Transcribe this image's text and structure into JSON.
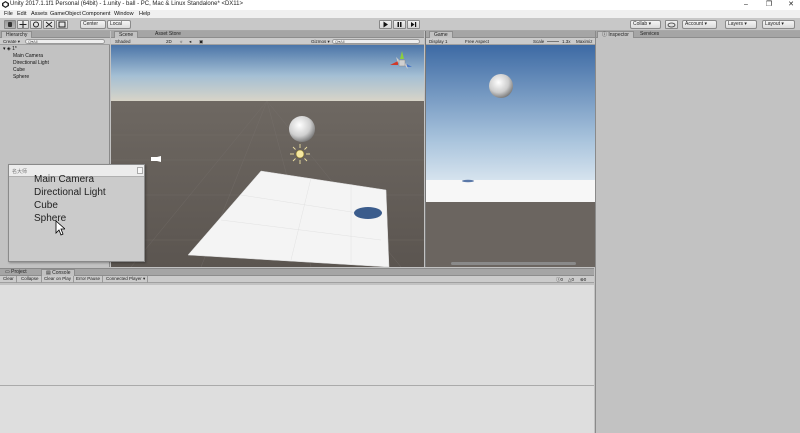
{
  "window": {
    "title": "Unity 2017.1.1f1 Personal (64bit) - 1.unity - ball - PC, Mac & Linux Standalone* <DX11>",
    "controls": [
      "–",
      "❐",
      "✕"
    ]
  },
  "menu": [
    "File",
    "Edit",
    "Assets",
    "GameObject",
    "Component",
    "Window",
    "Help"
  ],
  "toolbar": {
    "pivot": "Center",
    "space": "Local",
    "collab": "Collab ▾",
    "account": "Account ▾",
    "layers": "Layers ▾",
    "layout": "Layout ▾"
  },
  "hierarchy": {
    "tab": "Hierarchy",
    "create": "Create ▾",
    "search_placeholder": "Q▾All",
    "scene_name": "1*",
    "items": [
      "Main Camera",
      "Directional Light",
      "Cube",
      "Sphere"
    ]
  },
  "scene": {
    "tabs": [
      "Scene",
      "Asset Store"
    ],
    "shading": "Shaded",
    "mode_2d": "2D",
    "gizmos": "Gizmos ▾",
    "search_placeholder": "Q▾All"
  },
  "game": {
    "tab": "Game",
    "display": "Display 1",
    "aspect": "Free Aspect",
    "scale_label": "Scale",
    "scale_value": "1.3x",
    "maximize": "Maximiz"
  },
  "inspector": {
    "tabs": [
      "Inspector",
      "Services"
    ]
  },
  "bottom": {
    "tabs": [
      "Project",
      "Console"
    ],
    "buttons": [
      "Clear",
      "Collapse",
      "Clear on Play",
      "Error Pause",
      "Connected Player ▾"
    ],
    "counts": [
      "0",
      "0",
      "0"
    ]
  },
  "zoom_popup": {
    "header": "名大师",
    "items": [
      "Main Camera",
      "Directional Light",
      "Cube",
      "Sphere"
    ]
  }
}
